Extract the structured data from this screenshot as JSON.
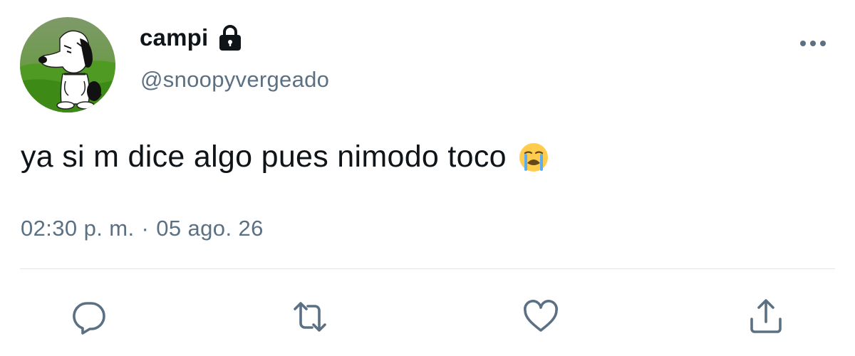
{
  "author": {
    "display_name": "campi",
    "handle": "@snoopyvergeado",
    "protected": true
  },
  "tweet": {
    "text": "ya si m dice algo pues nimodo toco",
    "emoji": "loudly-crying-face-icon"
  },
  "meta": {
    "time": "02:30 p. m.",
    "separator": "·",
    "date": "05 ago. 26"
  },
  "actions": {
    "reply_icon": "comment-icon",
    "retweet_icon": "retweet-icon",
    "like_icon": "heart-icon",
    "share_icon": "share-icon"
  },
  "colors": {
    "text_primary": "#0f1419",
    "text_secondary": "#5b7083",
    "icon": "#5b7083",
    "divider": "#e1e8ed"
  }
}
